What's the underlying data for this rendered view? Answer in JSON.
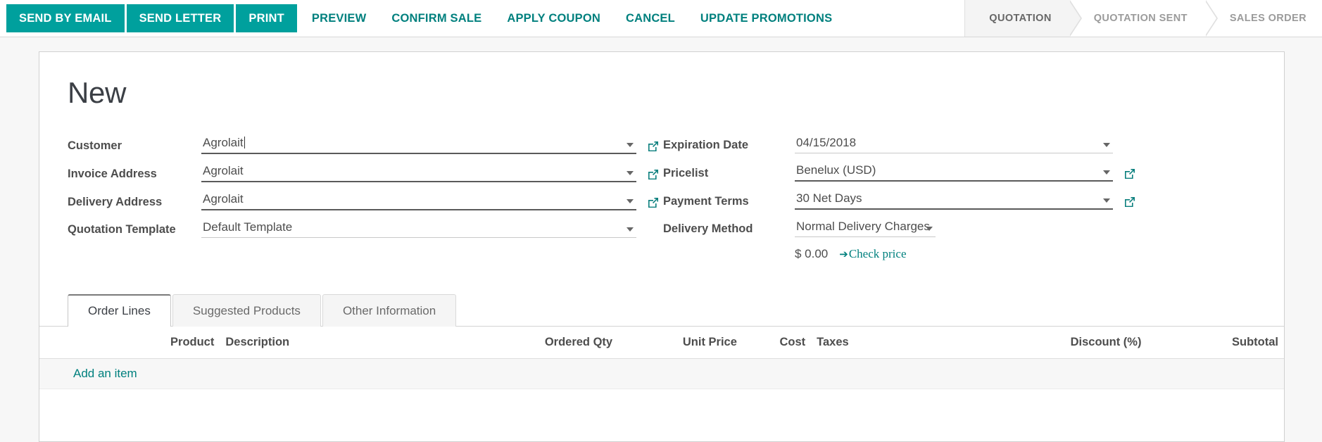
{
  "control_panel": {
    "primary_buttons": [
      {
        "label": "SEND BY EMAIL",
        "name": "send-by-email-button"
      },
      {
        "label": "SEND LETTER",
        "name": "send-letter-button"
      },
      {
        "label": "PRINT",
        "name": "print-button"
      }
    ],
    "link_buttons": [
      {
        "label": "PREVIEW",
        "name": "preview-button"
      },
      {
        "label": "CONFIRM SALE",
        "name": "confirm-sale-button"
      },
      {
        "label": "APPLY COUPON",
        "name": "apply-coupon-button"
      },
      {
        "label": "CANCEL",
        "name": "cancel-button"
      },
      {
        "label": "UPDATE PROMOTIONS",
        "name": "update-promotions-button"
      }
    ],
    "accent_color": "#00a09d",
    "link_color": "#00807e"
  },
  "statusbar": {
    "stages": [
      {
        "label": "QUOTATION",
        "active": true
      },
      {
        "label": "QUOTATION SENT",
        "active": false
      },
      {
        "label": "SALES ORDER",
        "active": false
      }
    ]
  },
  "record": {
    "title": "New"
  },
  "form": {
    "left": [
      {
        "label": "Customer",
        "value": "Agrolait",
        "has_caret": true,
        "has_dropdown": true,
        "has_external": true,
        "underline": "dark"
      },
      {
        "label": "Invoice Address",
        "value": "Agrolait",
        "has_caret": false,
        "has_dropdown": true,
        "has_external": true,
        "underline": "dark"
      },
      {
        "label": "Delivery Address",
        "value": "Agrolait",
        "has_caret": false,
        "has_dropdown": true,
        "has_external": true,
        "underline": "dark"
      },
      {
        "label": "Quotation Template",
        "value": "Default Template",
        "has_caret": false,
        "has_dropdown": true,
        "has_external": false,
        "underline": "light"
      }
    ],
    "right": [
      {
        "label": "Expiration Date",
        "value": "04/15/2018",
        "has_dropdown": true,
        "has_external": false,
        "underline": "light",
        "width": "wide"
      },
      {
        "label": "Pricelist",
        "value": "Benelux (USD)",
        "has_dropdown": true,
        "has_external": true,
        "underline": "dark",
        "width": "wide"
      },
      {
        "label": "Payment Terms",
        "value": "30 Net Days",
        "has_dropdown": true,
        "has_external": true,
        "underline": "dark",
        "width": "wide"
      },
      {
        "label": "Delivery Method",
        "value": "Normal Delivery Charges",
        "has_dropdown": true,
        "has_external": false,
        "underline": "light",
        "width": "narrow"
      }
    ],
    "delivery_price": "$ 0.00",
    "check_price_label": "Check price",
    "check_price_arrow": "➔"
  },
  "notebook": {
    "tabs": [
      {
        "label": "Order Lines",
        "active": true
      },
      {
        "label": "Suggested Products",
        "active": false
      },
      {
        "label": "Other Information",
        "active": false
      }
    ]
  },
  "order_lines": {
    "columns": [
      "Product",
      "Description",
      "Ordered Qty",
      "Unit Price",
      "Cost",
      "Taxes",
      "Discount (%)",
      "Subtotal"
    ],
    "rows": [],
    "add_item_label": "Add an item"
  }
}
